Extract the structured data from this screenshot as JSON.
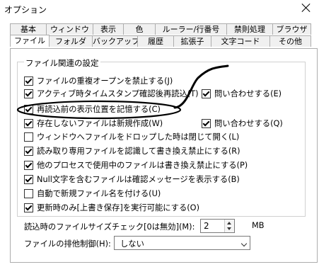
{
  "window": {
    "title": "オプション"
  },
  "tabs_row1": [
    "基本",
    "ウィンドウ",
    "表示",
    "色",
    "ルーラー/行番号",
    "禁則処理",
    "ブラウザ"
  ],
  "tabs_row2": [
    "ファイル",
    "フォルダ",
    "バックアップ",
    "履歴",
    "拡張子",
    "文字コード",
    "その他"
  ],
  "active_tab": "ファイル",
  "group": {
    "title": "ファイル関連の設定",
    "options": [
      {
        "label": "ファイルの重複オープンを禁止する(J)",
        "checked": true
      },
      {
        "label": "アクティブ時タイムスタンプ確認後再読込(T)",
        "checked": true
      },
      {
        "label": "再読込前の表示位置を記憶する(C)",
        "checked": true
      },
      {
        "label": "存在しないファイルは新規作成(W)",
        "checked": true
      },
      {
        "label": "ウィンドウへファイルをドロップした時は閉じて開く(L)",
        "checked": false
      },
      {
        "label": "読み取り専用ファイルを認識して書き換え禁止にする(R)",
        "checked": true
      },
      {
        "label": "他のプロセスで使用中のファイルは書き換え禁止にする(P)",
        "checked": true
      },
      {
        "label": "Null文字を含むファイルは確認メッセージを表示する(B)",
        "checked": true
      },
      {
        "label": "自動で新規ファイル名を付ける(U)",
        "checked": false
      },
      {
        "label": "更新時のみ[上書き保存]を実行可能にする(O)",
        "checked": true
      }
    ],
    "ask_options": [
      {
        "label": "問い合わせする(E)",
        "checked": true
      },
      {
        "label": "問い合わせする(Q)",
        "checked": true
      }
    ]
  },
  "size_check": {
    "label": "読込時のファイルサイズチェック[0は無効](M):",
    "value": "2",
    "unit": "MB"
  },
  "lock": {
    "label": "ファイルの排他制御(H):",
    "value": "しない"
  }
}
